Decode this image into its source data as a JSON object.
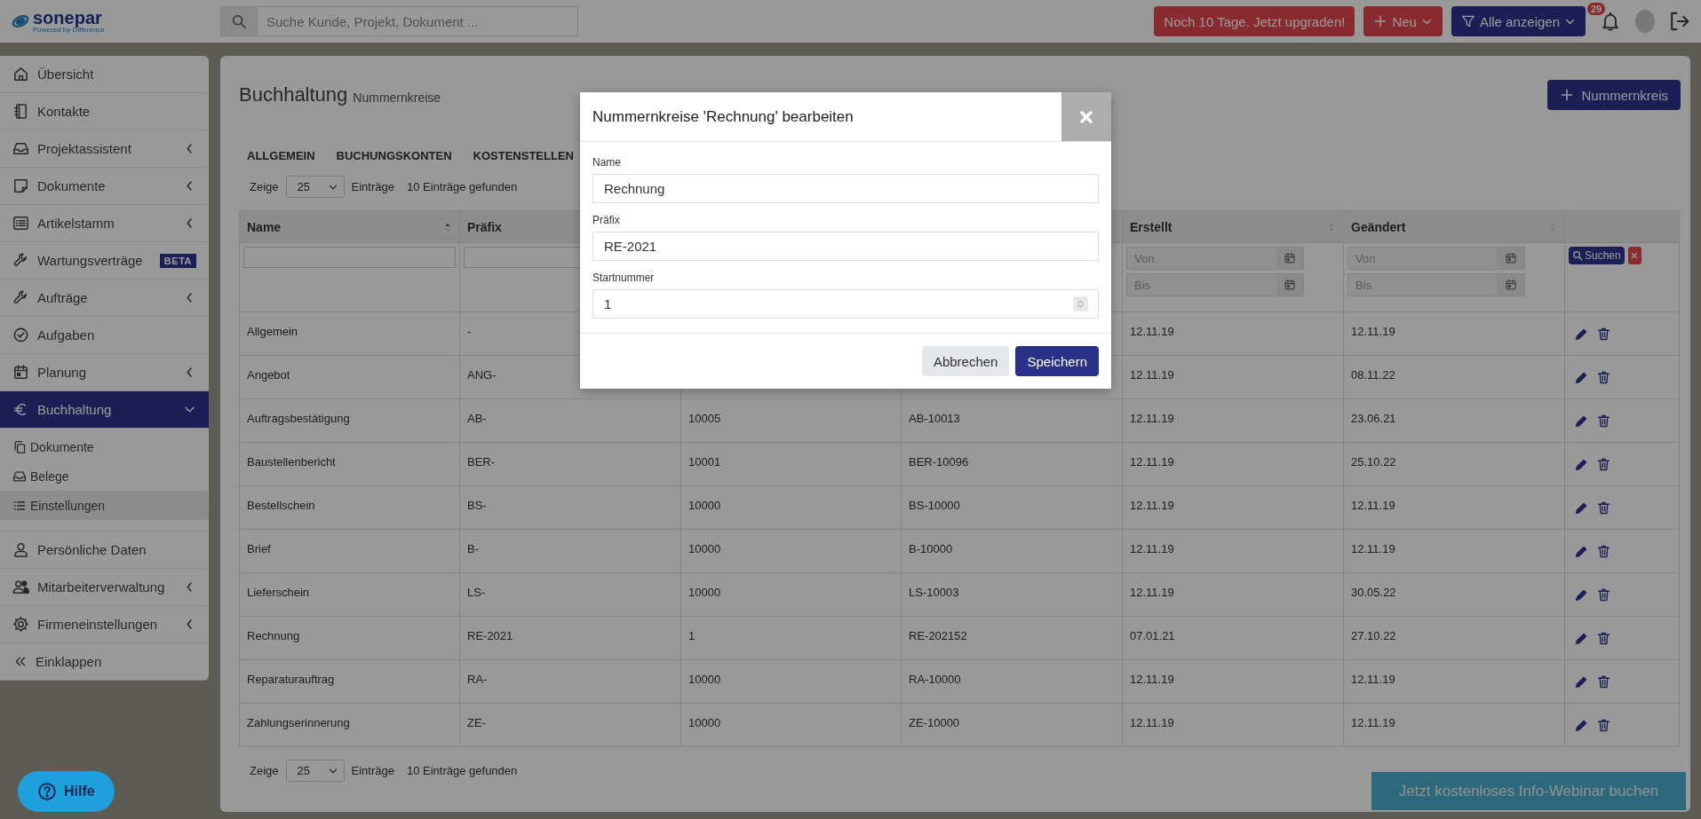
{
  "topbar": {
    "logo": "sonepar",
    "logo_tagline": "Powered by Difference",
    "search": {
      "placeholder": "Suche Kunde, Projekt, Dokument ..."
    },
    "upgrade_button": "Noch 10 Tage. Jetzt upgraden!",
    "new_button": "Neu",
    "filter_button": "Alle anzeigen",
    "notification_count": "29"
  },
  "sidebar": {
    "items": [
      {
        "label": "Übersicht",
        "kind": "link",
        "selected": false
      },
      {
        "label": "Kontakte",
        "kind": "link",
        "selected": false
      },
      {
        "label": "Projektassistent",
        "kind": "group",
        "selected": false,
        "expanded": false
      },
      {
        "label": "Dokumente",
        "kind": "group",
        "selected": false,
        "expanded": false
      },
      {
        "label": "Artikelstamm",
        "kind": "group",
        "selected": false,
        "expanded": false
      },
      {
        "label": "Wartungsverträge",
        "kind": "link",
        "selected": false,
        "badge": "BETA"
      },
      {
        "label": "Aufträge",
        "kind": "group",
        "selected": false,
        "expanded": false
      },
      {
        "label": "Aufgaben",
        "kind": "link",
        "selected": false
      },
      {
        "label": "Planung",
        "kind": "group",
        "selected": false,
        "expanded": false
      },
      {
        "label": "Buchhaltung",
        "kind": "group",
        "selected": true,
        "expanded": true,
        "children": [
          {
            "label": "Dokumente",
            "selected": false
          },
          {
            "label": "Belege",
            "selected": false
          },
          {
            "label": "Einstellungen",
            "selected": true
          }
        ]
      },
      {
        "label": "Persönliche Daten",
        "kind": "link",
        "selected": false
      },
      {
        "label": "Mitarbeiterverwaltung",
        "kind": "group",
        "selected": false,
        "expanded": false
      },
      {
        "label": "Firmeneinstellungen",
        "kind": "group",
        "selected": false,
        "expanded": false
      }
    ],
    "collapse": "Einklappen"
  },
  "main": {
    "title": "Buchhaltung",
    "subtitle": "Nummernkreise",
    "add_button": "Nummernkreis",
    "tabs": [
      {
        "label": "ALLGEMEIN",
        "selected": false
      },
      {
        "label": "BUCHUNGSKONTEN",
        "selected": false
      },
      {
        "label": "KOSTENSTELLEN",
        "selected": false
      }
    ],
    "page_length_top": {
      "label": "Zeige",
      "value": "25",
      "unit": "Einträge",
      "info": "10 Einträge gefunden"
    },
    "table": {
      "columns": [
        {
          "label": "Name",
          "sortable": true,
          "sorted": true
        },
        {
          "label": "Präfix"
        },
        {},
        {},
        {
          "label": "Erstellt",
          "sortable": true,
          "sorted": false
        },
        {
          "label": "Geändert",
          "sortable": true,
          "sorted": false
        }
      ],
      "filters": [
        {
          "kind": "text"
        },
        {
          "kind": "text"
        },
        {
          "kind": "none"
        },
        {
          "kind": "none"
        },
        {
          "kind": "date_range",
          "from_placeholder": "Von",
          "to_placeholder": "Bis"
        },
        {
          "kind": "date_range",
          "from_placeholder": "Von",
          "to_placeholder": "Bis"
        }
      ],
      "search_button": "Suchen",
      "rows": [
        [
          "Allgemein",
          "-",
          null,
          null,
          "12.11.19",
          "12.11.19"
        ],
        [
          "Angebot",
          "ANG-",
          null,
          null,
          "12.11.19",
          "08.11.22"
        ],
        [
          "Auftragsbestätigung",
          "AB-",
          "10005",
          "AB-10013",
          "12.11.19",
          "23.06.21"
        ],
        [
          "Baustellenbericht",
          "BER-",
          "10001",
          "BER-10096",
          "12.11.19",
          "25.10.22"
        ],
        [
          "Bestellschein",
          "BS-",
          "10000",
          "BS-10000",
          "12.11.19",
          "12.11.19"
        ],
        [
          "Brief",
          "B-",
          "10000",
          "B-10000",
          "12.11.19",
          "12.11.19"
        ],
        [
          "Lieferschein",
          "LS-",
          "10000",
          "LS-10003",
          "12.11.19",
          "30.05.22"
        ],
        [
          "Rechnung",
          "RE-2021",
          "1",
          "RE-202152",
          "07.01.21",
          "27.10.22"
        ],
        [
          "Reparaturauftrag",
          "RA-",
          "10000",
          "RA-10000",
          "12.11.19",
          "12.11.19"
        ],
        [
          "Zahlungserinnerung",
          "ZE-",
          "10000",
          "ZE-10000",
          "12.11.19",
          "12.11.19"
        ]
      ]
    },
    "page_length_bottom": {
      "label": "Zeige",
      "value": "25",
      "unit": "Einträge",
      "info": "10 Einträge gefunden"
    }
  },
  "modal": {
    "title": "Nummernkreise 'Rechnung' bearbeiten",
    "fields": [
      {
        "label": "Name",
        "value": "Rechnung",
        "kind": "text"
      },
      {
        "label": "Präfix",
        "value": "RE-2021",
        "kind": "text"
      },
      {
        "label": "Startnummer",
        "value": "1",
        "kind": "number"
      }
    ],
    "cancel_button": "Abbrechen",
    "save_button": "Speichern"
  },
  "help_button": "Hilfe",
  "webinar_button": "Jetzt kostenloses Info-Webinar buchen"
}
